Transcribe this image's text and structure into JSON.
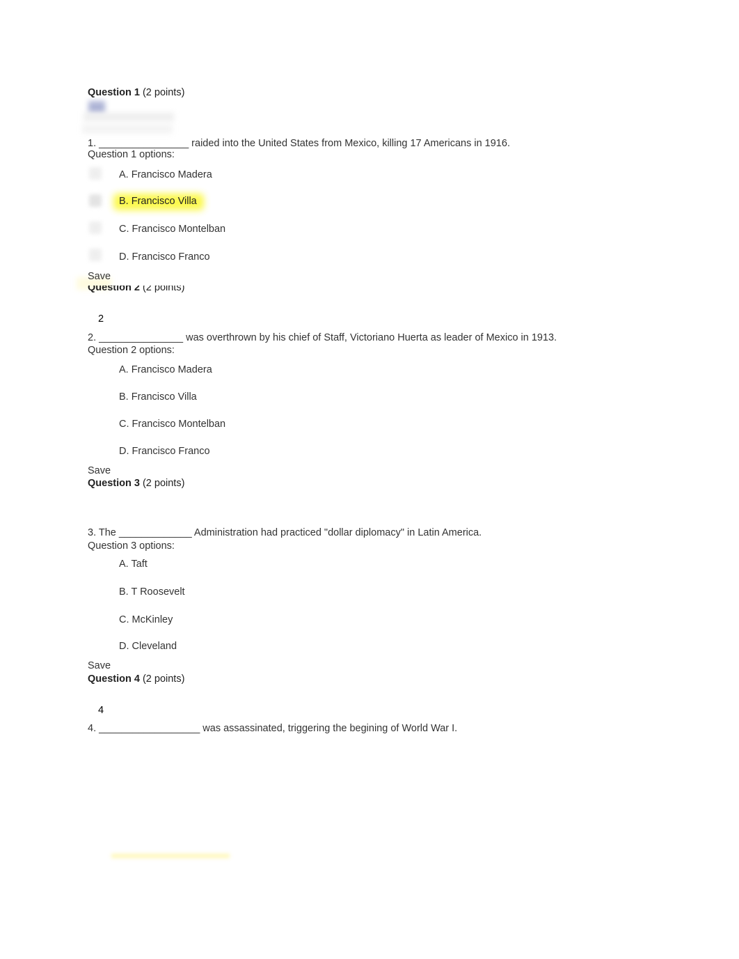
{
  "questions": [
    {
      "header_bold": "Question 1",
      "header_points": " (2 points)",
      "number_label": "",
      "prompt": "1. ________________ raided into the United States from Mexico, killing 17 Americans in 1916.",
      "options_label": "Question 1 options:",
      "options": [
        "A. Francisco Madera",
        "B. Francisco Villa",
        "C. Francisco Montelban",
        "D. Francisco Franco"
      ],
      "highlighted_option_index": 1,
      "save_label": "Save"
    },
    {
      "header_bold": "Question 2",
      "header_points": " (2 points)",
      "number_label": "2",
      "prompt": "2. _______________ was overthrown by his chief of Staff, Victoriano Huerta as leader of Mexico in 1913.",
      "options_label": "Question 2 options:",
      "options": [
        "A. Francisco Madera",
        "B. Francisco Villa",
        "C. Francisco Montelban",
        "D. Francisco Franco"
      ],
      "save_label": "Save"
    },
    {
      "header_bold": "Question 3",
      "header_points": " (2 points)",
      "number_label": "",
      "prompt": "3. The _____________ Administration had practiced \"dollar diplomacy\" in Latin America.",
      "options_label": "Question 3 options:",
      "options": [
        "A. Taft",
        "B. T Roosevelt",
        "C. McKinley",
        "D. Cleveland"
      ],
      "save_label": "Save"
    },
    {
      "header_bold": "Question 4",
      "header_points": " (2 points)",
      "number_label": "4",
      "prompt": "4. __________________ was assassinated, triggering the begining of World War I."
    }
  ],
  "colors": {
    "highlight": "#fbf83a",
    "text": "#333333"
  }
}
